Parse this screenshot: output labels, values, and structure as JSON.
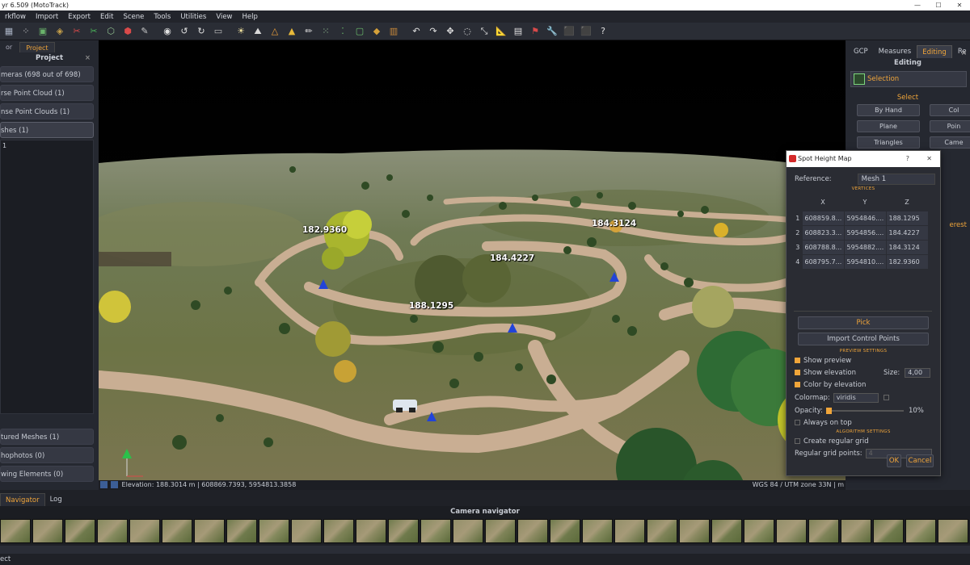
{
  "window": {
    "title": "yr 6.509 (MotoTrack)",
    "controls": [
      "—",
      "☐",
      "✕"
    ]
  },
  "menu": [
    "rkflow",
    "Import",
    "Export",
    "Edit",
    "Scene",
    "Tools",
    "Utilities",
    "View",
    "Help"
  ],
  "toolbar": {
    "icons": [
      "grid-icon",
      "points-icon",
      "cube-icon",
      "cube-multi-icon",
      "cut-icon",
      "cut-green-icon",
      "mesh-icon",
      "mesh-red-icon",
      "brush-icon",
      "camera-icon",
      "rotate-ccw-icon",
      "rotate-cw-icon",
      "rect-icon",
      "bulb-icon",
      "peaks-icon",
      "triangle-icon",
      "pyramid-icon",
      "pencil-icon",
      "scatter-icon",
      "dots-icon",
      "box-icon",
      "cube-color-icon",
      "frame-icon",
      "undo-icon",
      "redo-icon",
      "move-icon",
      "orbit-icon",
      "scale-icon",
      "ruler-icon",
      "layers-icon",
      "flag-icon",
      "wrench-icon",
      "cube-blue-icon",
      "cube-red-icon",
      "help-icon"
    ],
    "glyphs": [
      "▦",
      "⁘",
      "▣",
      "◈",
      "✂",
      "✂",
      "⬡",
      "⬢",
      "✎",
      "◉",
      "↺",
      "↻",
      "▭",
      "☀",
      "⛰",
      "△",
      "▲",
      "✏",
      "⁙",
      "⁚",
      "▢",
      "◆",
      "▥",
      "↶",
      "↷",
      "✥",
      "◌",
      "⤡",
      "📐",
      "▤",
      "⚑",
      "🔧",
      "⬛",
      "⬛",
      "?"
    ],
    "colors": [
      "#a9b2c4",
      "#d9d9d9",
      "#6ab36b",
      "#c9a24a",
      "#d94a4a",
      "#4ab45a",
      "#8fbf8f",
      "#d94a4a",
      "#c9c9c9",
      "#e0e0e0",
      "#e0e0e0",
      "#e0e0e0",
      "#bdbdbd",
      "#f2e3a0",
      "#d9d9d9",
      "#f2a33a",
      "#e8b93a",
      "#e0e0e0",
      "#9ac79a",
      "#6cbf6c",
      "#6cbf6c",
      "#d6a13a",
      "#c98a3a",
      "#e0e0e0",
      "#e0e0e0",
      "#e0e0e0",
      "#e0e0e0",
      "#e0e0e0",
      "#e0e0e0",
      "#e0e0e0",
      "#d94a4a",
      "#e0e0e0",
      "#5b8de0",
      "#d94a4a",
      "#e0e0e0"
    ]
  },
  "left_panel": {
    "tabs": [
      "or",
      "Project"
    ],
    "title": "Project",
    "close": "×",
    "items": [
      "meras (698 out of 698)",
      "rse Point Cloud (1)",
      "nse Point Clouds (1)",
      "shes (1)"
    ],
    "tree_first": "1",
    "bottom_items": [
      "tured Meshes (1)",
      "hophotos (0)",
      "wing Elements (0)"
    ]
  },
  "viewport": {
    "labels": [
      "182.9360",
      "184.4227",
      "184.3124",
      "188.1295"
    ],
    "status": "Elevation: 188.3014 m | 608869.7393, 5954813.3858",
    "crs": "WGS 84 / UTM zone 33N | m"
  },
  "right_panel": {
    "tabs": [
      "GCP",
      "Measures",
      "Editing",
      "Re"
    ],
    "title": "Editing",
    "close": "×",
    "selection": "Selection",
    "select_heading": "Select",
    "buttons": [
      "By Hand",
      "Col",
      "Plane",
      "Poin",
      "Triangles",
      "Came"
    ],
    "frag1": "erest"
  },
  "dialog": {
    "title": "Spot Height Map",
    "help": "?",
    "close": "✕",
    "reference_label": "Reference:",
    "reference_value": "Mesh 1",
    "vertices_heading": "VERTICES",
    "columns": [
      "X",
      "Y",
      "Z"
    ],
    "rows": [
      {
        "n": "1",
        "x": "608859.8...",
        "y": "5954846....",
        "z": "188.1295"
      },
      {
        "n": "2",
        "x": "608823.3...",
        "y": "5954856....",
        "z": "184.4227"
      },
      {
        "n": "3",
        "x": "608788.8...",
        "y": "5954882....",
        "z": "184.3124"
      },
      {
        "n": "4",
        "x": "608795.7...",
        "y": "5954810....",
        "z": "182.9360"
      }
    ],
    "pick": "Pick",
    "import_cp": "Import Control Points",
    "preview_heading": "PREVIEW SETTINGS",
    "show_preview": "Show preview",
    "show_elevation": "Show elevation",
    "size_label": "Size:",
    "size_value": "4,00",
    "color_by_elev": "Color by elevation",
    "colormap_label": "Colormap:",
    "colormap_value": "viridis",
    "opacity_label": "Opacity:",
    "opacity_value": "10%",
    "always_on_top": "Always on top",
    "algorithm_heading": "ALGORITHM SETTINGS",
    "create_grid": "Create regular grid",
    "grid_points_label": "Regular grid points:",
    "grid_points_value": "4",
    "ok": "OK",
    "cancel": "Cancel"
  },
  "bottom": {
    "tabs": [
      "Navigator",
      "Log"
    ],
    "camera_navigator": "Camera navigator",
    "strip_label": "ect",
    "thumb_count": 30
  }
}
